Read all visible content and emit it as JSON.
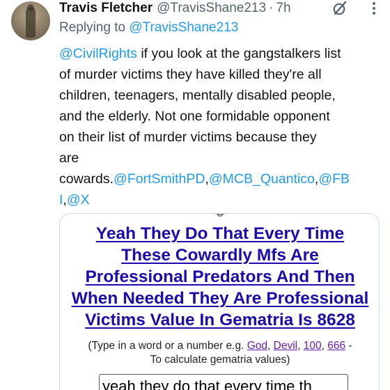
{
  "author": {
    "display_name": "Travis Fletcher",
    "handle": "@TravisShane213",
    "separator": "·",
    "time": "7h"
  },
  "reply": {
    "prefix": "Replying to",
    "to": "@TravisShane213"
  },
  "tweet": {
    "mention_start": "@CivilRights",
    "line1_rest": " if you look at the gangstalkers list",
    "line2": "of murder victims they have killed they're all",
    "line3": "children, teenagers, mentally disabled people,",
    "line4": "and the elderly. Not one formidable opponent",
    "line5": "on their list of murder victims because they",
    "line6": "are",
    "line7_text": "cowards.",
    "mention_fortsmith": "@FortSmithPD",
    "comma1": ",",
    "mention_mcb": "@MCB_Quantico",
    "comma2": ",",
    "mention_fbi_part1": "@FB",
    "mention_fbi_part2": "I",
    "comma3": ",",
    "mention_x": "@X"
  },
  "media": {
    "headline_lines": [
      "Yeah They Do That Every Time",
      "These Cowardly Mfs Are",
      "Professional Predators And Then",
      "When Needed They Are Professional",
      "Victims Value In Gematria Is 8628"
    ],
    "hint_prefix": "(Type in a word or a number e.g. ",
    "hint_god": "God",
    "hint_sep1": ", ",
    "hint_devil": "Devil",
    "hint_sep2": ", ",
    "hint_100": "100",
    "hint_sep3": ", ",
    "hint_666": "666",
    "hint_suffix": " -",
    "hint_line2": "To calculate gematria values)",
    "input_value": "yeah they do that every time th"
  },
  "icons": {
    "grok": "grok-icon",
    "more": "more-icon"
  },
  "colors": {
    "link_blue": "#1d9bf0",
    "secondary_text": "#536471",
    "headline_link": "#1a0dab",
    "visited_link": "#681da8"
  }
}
